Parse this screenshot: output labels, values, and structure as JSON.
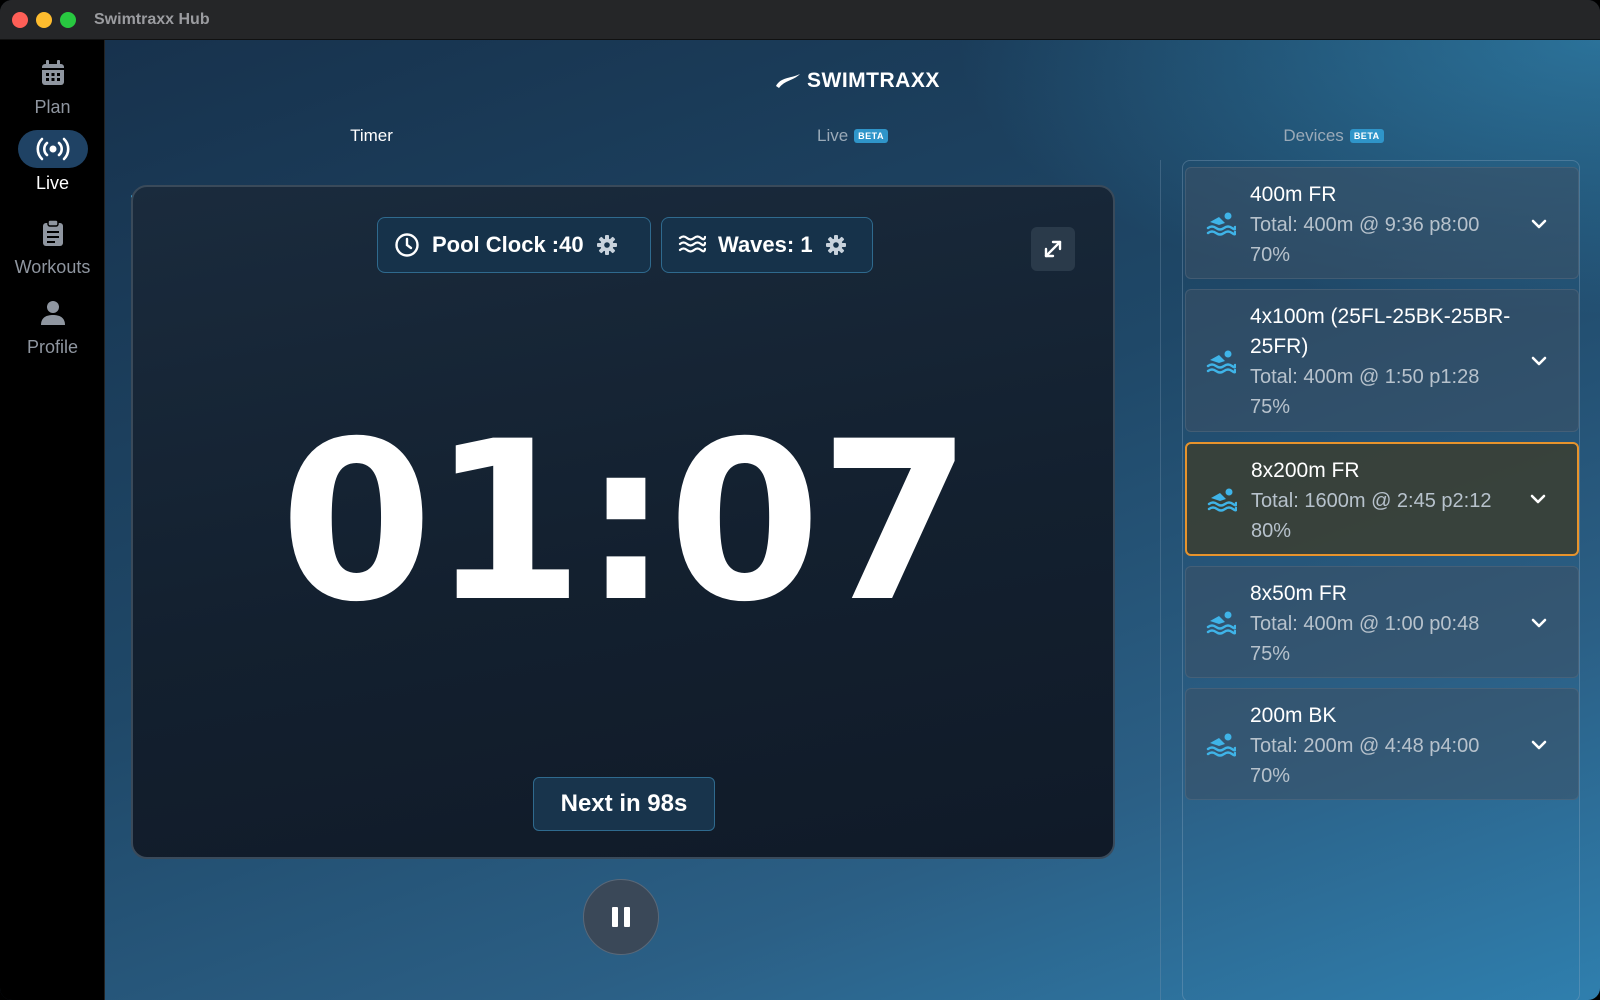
{
  "window": {
    "title": "Swimtraxx Hub"
  },
  "sidebar": {
    "items": [
      {
        "label": "Plan",
        "icon": "calendar-icon",
        "active": false
      },
      {
        "label": "Live",
        "icon": "broadcast-icon",
        "active": true
      },
      {
        "label": "Workouts",
        "icon": "clipboard-icon",
        "active": false
      },
      {
        "label": "Profile",
        "icon": "person-icon",
        "active": false
      }
    ]
  },
  "header": {
    "logo": "SWIMTRAXX"
  },
  "tabs": [
    {
      "label": "Timer",
      "badge": "",
      "active": true
    },
    {
      "label": "Live",
      "badge": "BETA",
      "active": false
    },
    {
      "label": "Devices",
      "badge": "BETA",
      "active": false
    }
  ],
  "timer": {
    "pool_clock_label": "Pool Clock :40",
    "waves_label": "Waves: 1",
    "time": "01:07",
    "next_label": "Next in 98s"
  },
  "workouts": [
    {
      "title": "400m FR",
      "detail": "Total: 400m @ 9:36 p8:00 70%",
      "selected": false
    },
    {
      "title": "4x100m (25FL-25BK-25BR-25FR)",
      "detail": "Total: 400m @ 1:50 p1:28 75%",
      "selected": false
    },
    {
      "title": "8x200m FR",
      "detail": "Total: 1600m @ 2:45 p2:12 80%",
      "selected": true
    },
    {
      "title": "8x50m FR",
      "detail": "Total: 400m @ 1:00 p0:48 75%",
      "selected": false
    },
    {
      "title": "200m BK",
      "detail": "Total: 200m @ 4:48 p4:00 70%",
      "selected": false
    }
  ],
  "colors": {
    "accent": "#3fb4e8",
    "selected_border": "#e7932c",
    "beta_badge": "#2f95c9"
  }
}
